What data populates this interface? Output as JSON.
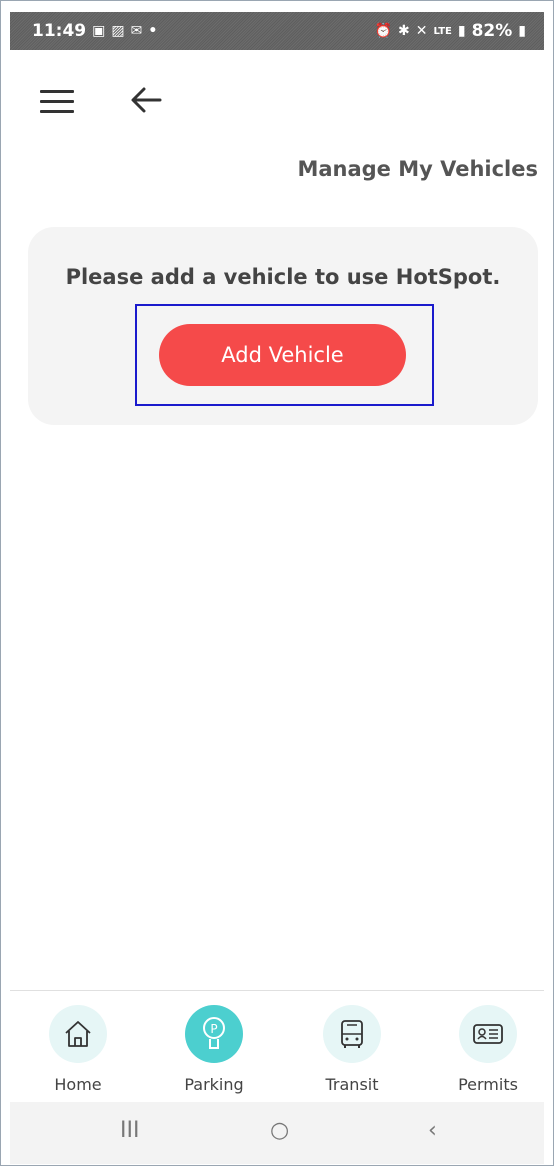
{
  "status_bar": {
    "time": "11:49",
    "left_icons": [
      "teams-icon",
      "gallery-icon",
      "mail-icon",
      "dot-icon"
    ],
    "right_icons": [
      "alarm-icon",
      "bluetooth-icon",
      "mute-icon",
      "lte-icon",
      "signal-icon"
    ],
    "battery": "82%"
  },
  "header": {
    "menu_icon": "hamburger-icon",
    "back_icon": "arrow-left-icon",
    "title": "Manage My Vehicles"
  },
  "card": {
    "message": "Please add a vehicle to use HotSpot.",
    "button_label": "Add Vehicle",
    "button_color": "#f54a4a"
  },
  "bottom_nav": {
    "items": [
      {
        "label": "Home",
        "icon": "home-icon"
      },
      {
        "label": "Parking",
        "icon": "parking-meter-icon",
        "active": true
      },
      {
        "label": "Transit",
        "icon": "bus-icon"
      },
      {
        "label": "Permits",
        "icon": "id-card-icon"
      }
    ],
    "active_color": "#4ccfcf"
  },
  "system_nav": {
    "recents": "III",
    "home": "○",
    "back": "‹"
  }
}
